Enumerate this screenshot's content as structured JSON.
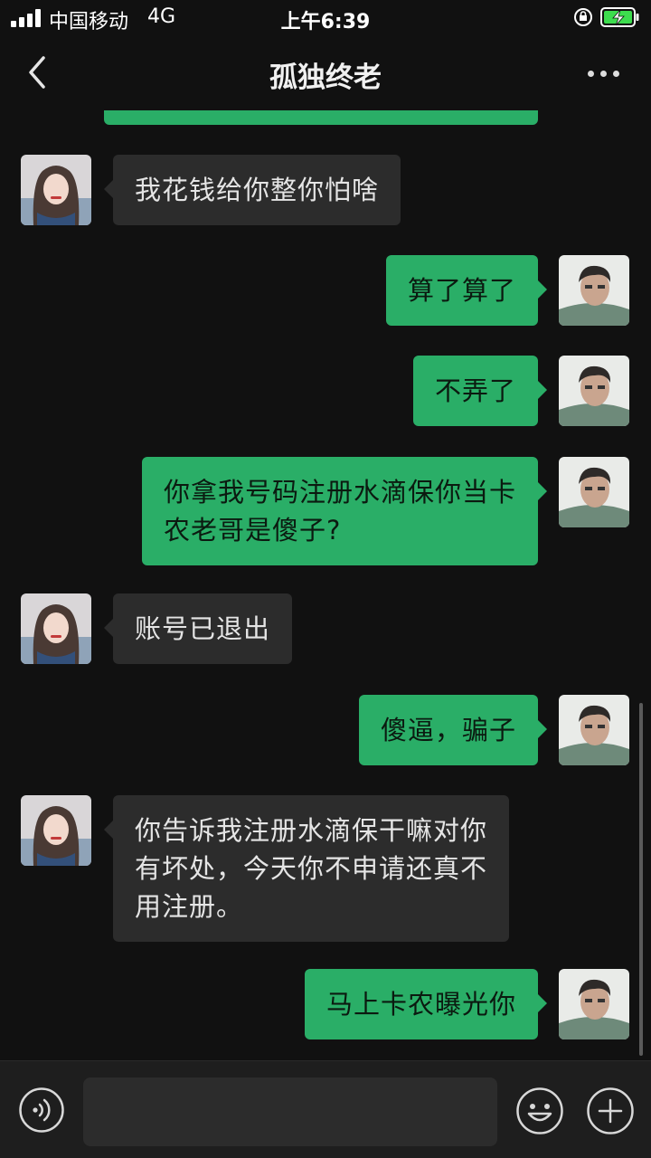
{
  "status_bar": {
    "carrier": "中国移动",
    "network": "4G",
    "time": "上午6:39"
  },
  "nav": {
    "title": "孤独终老"
  },
  "messages": [
    {
      "side": "in",
      "lines": [
        "我花钱给你整你怕啥"
      ]
    },
    {
      "side": "out",
      "lines": [
        "算了算了"
      ]
    },
    {
      "side": "out",
      "lines": [
        "不弄了"
      ]
    },
    {
      "side": "out",
      "lines": [
        "你拿我号码注册水滴保你当卡",
        "农老哥是傻子?"
      ]
    },
    {
      "side": "in",
      "lines": [
        "账号已退出"
      ]
    },
    {
      "side": "out",
      "lines": [
        "傻逼，骗子"
      ]
    },
    {
      "side": "in",
      "lines": [
        "你告诉我注册水滴保干嘛对你",
        "有坏处，今天你不申请还真不",
        "用注册。"
      ]
    },
    {
      "side": "out",
      "lines": [
        "马上卡农曝光你"
      ]
    }
  ],
  "input_bar": {
    "value": "",
    "icons": [
      "voice-icon",
      "emoji-icon",
      "plus-icon"
    ]
  },
  "colors": {
    "background": "#111111",
    "outgoing_bubble": "#2aae67",
    "incoming_bubble": "#2c2c2c",
    "input_bar": "#1e1e1e"
  }
}
